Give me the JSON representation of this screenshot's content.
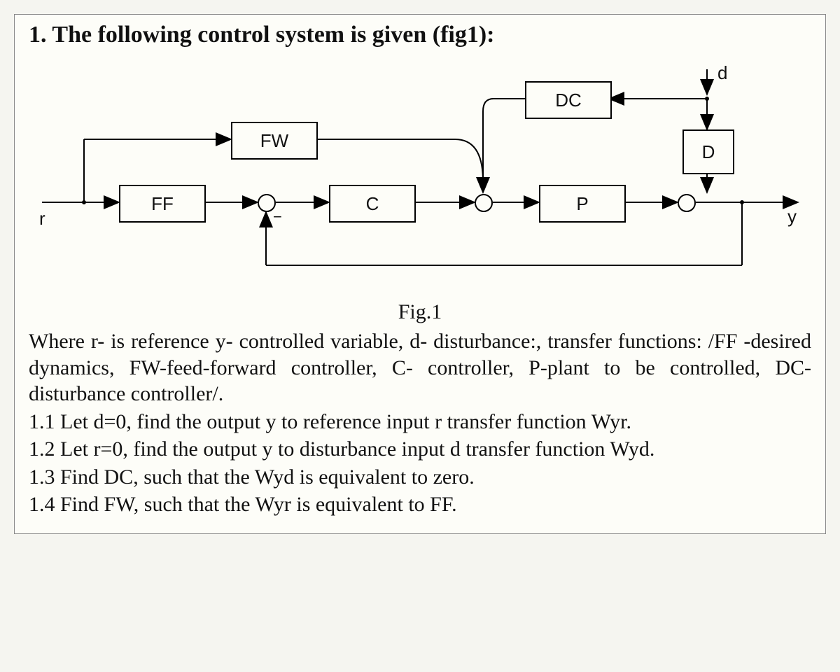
{
  "title": "1. The following control system is given (fig1):",
  "blocks": {
    "FF": "FF",
    "FW": "FW",
    "C": "C",
    "DC": "DC",
    "P": "P",
    "D": "D"
  },
  "signals": {
    "r": "r",
    "d": "d",
    "y": "y",
    "minus": "−"
  },
  "caption": "Fig.1",
  "para1": "Where r- is reference y- controlled variable, d- disturbance:, transfer functions: /FF -desired dynamics, FW-feed-forward controller, C- controller, P-plant to be controlled, DC-disturbance controller/.",
  "q11": "1.1 Let d=0, find the output y to reference input r transfer function Wyr.",
  "q12": "1.2 Let r=0, find the output y to disturbance input d transfer function Wyd.",
  "q13": "1.3 Find DC, such that the Wyd is equivalent to zero.",
  "q14": "1.4 Find FW, such that the Wyr is equivalent to FF."
}
